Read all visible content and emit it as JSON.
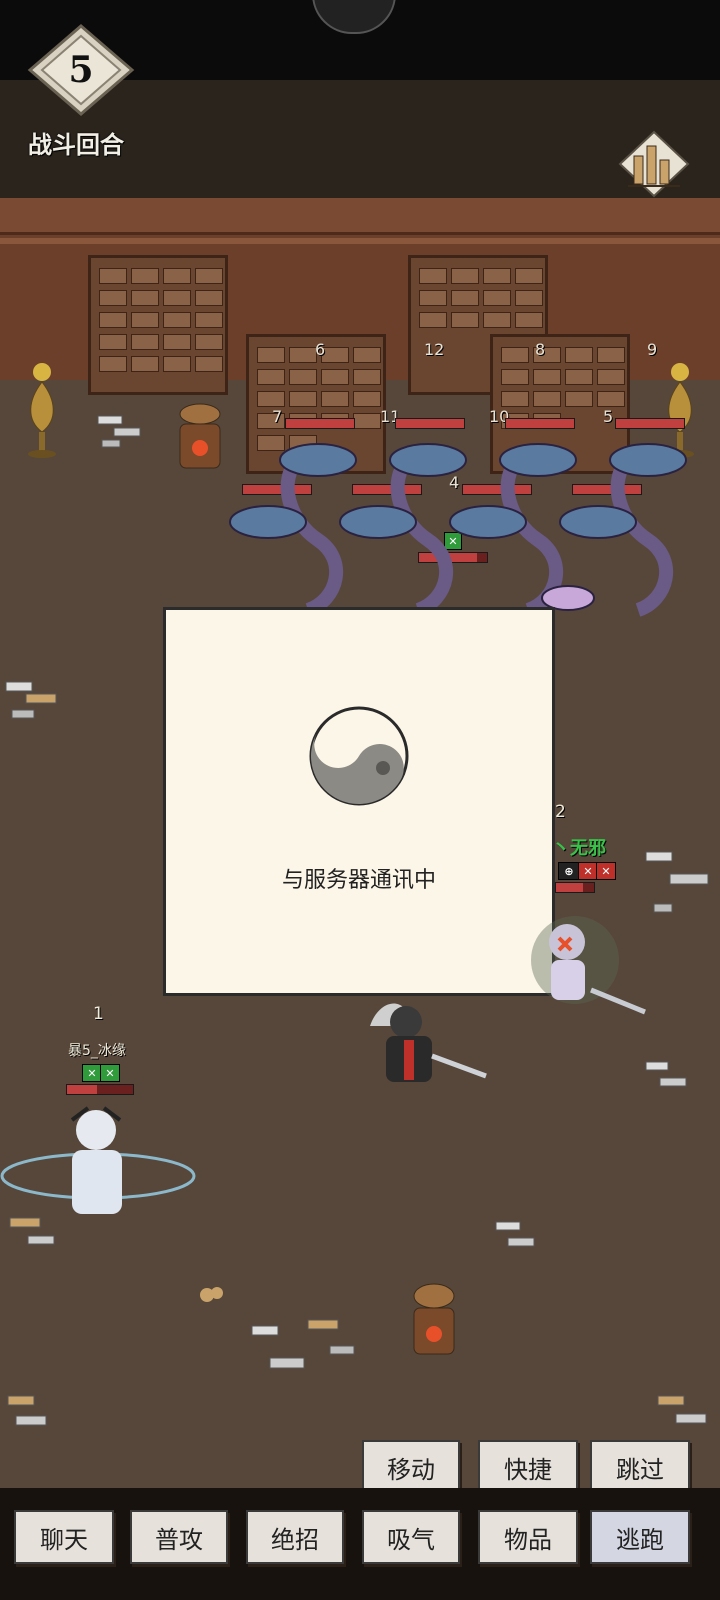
{
  "battle": {
    "round_number": "5",
    "round_label": "战斗回合"
  },
  "enemies": [
    {
      "num": "6"
    },
    {
      "num": "12"
    },
    {
      "num": "8"
    },
    {
      "num": "9"
    },
    {
      "num": "7"
    },
    {
      "num": "11"
    },
    {
      "num": "10"
    },
    {
      "num": "5"
    },
    {
      "num": "4"
    }
  ],
  "dialog": {
    "message": "与服务器通讯中"
  },
  "players": {
    "p1": {
      "num": "1",
      "name": "暴5_冰缘"
    },
    "p2": {
      "num": "2",
      "name": "丶无邪"
    }
  },
  "actions_top": {
    "move": "移动",
    "shortcut": "快捷",
    "skip": "跳过"
  },
  "actions_bottom": {
    "chat": "聊天",
    "attack": "普攻",
    "ultimate": "绝招",
    "breathe": "吸气",
    "items": "物品",
    "escape": "逃跑"
  },
  "colors": {
    "escape_button_bg": "#d4d6e2",
    "hp_red": "#c04040",
    "name_green": "#39c24a"
  }
}
